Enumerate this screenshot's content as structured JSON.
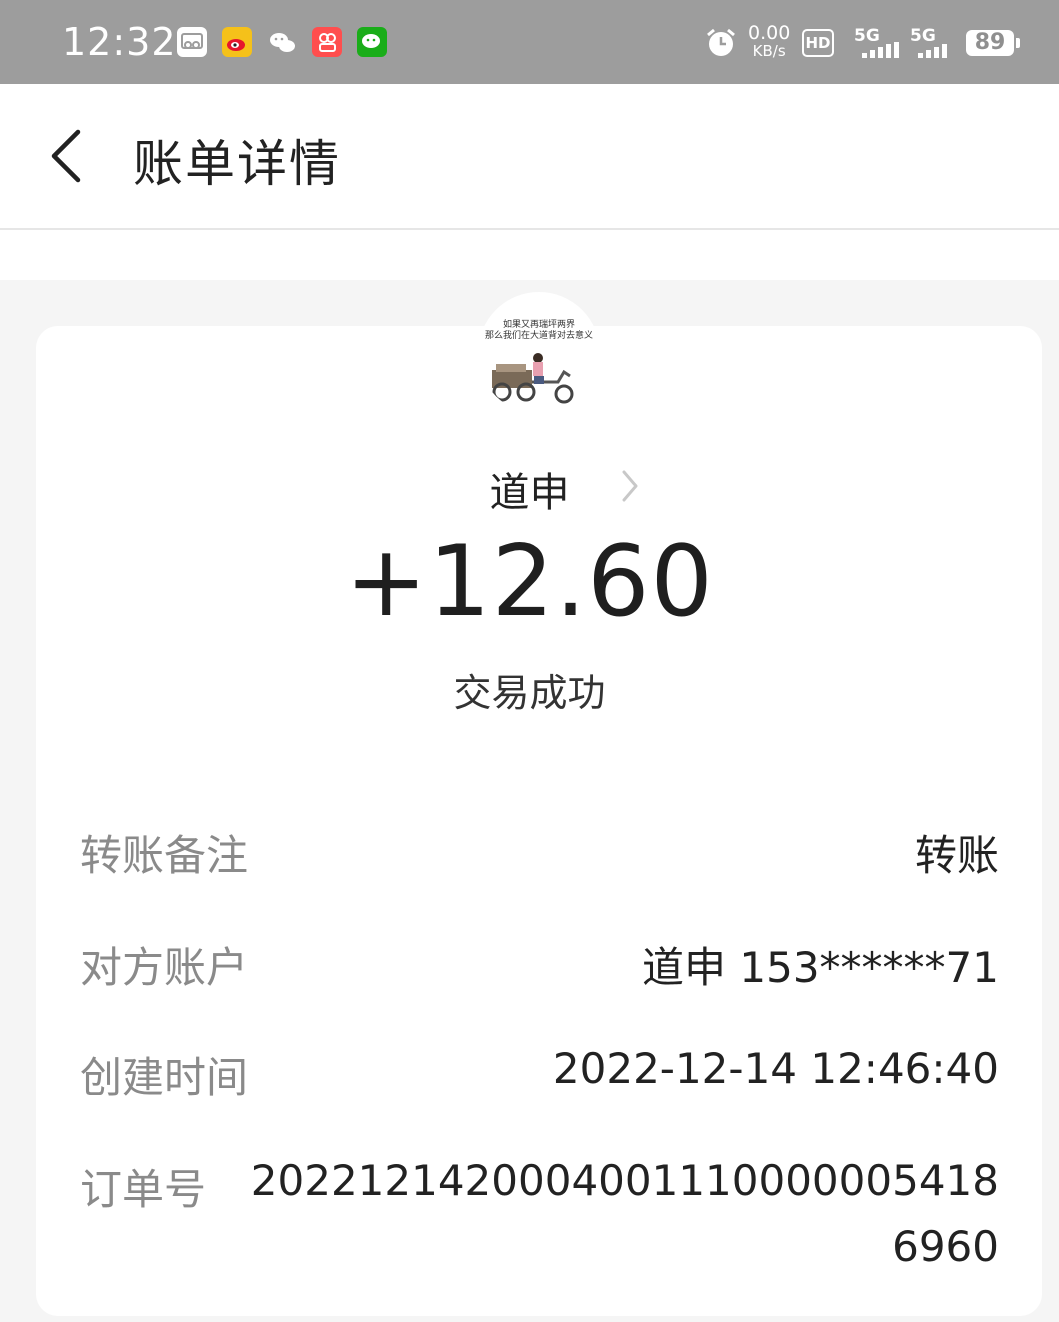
{
  "status_bar": {
    "time": "12:32",
    "net_speed": "0.00",
    "net_unit": "KB/s",
    "hd": "HD",
    "sim1": "5G",
    "sim2": "5G",
    "battery": "89",
    "app_icons": [
      "screen-mirror-icon",
      "weibo-icon",
      "wechat-icon",
      "xiaohongshu-icon",
      "wechat-app-icon"
    ],
    "alarm_icon": "alarm-icon"
  },
  "header": {
    "title": "账单详情",
    "back_icon": "chevron-left-icon"
  },
  "transaction": {
    "avatar_caption_line1": "如果又再瑞坪两界",
    "avatar_caption_line2": "那么我们在大道背对去意义",
    "counterparty_name": "道申",
    "amount": "+12.60",
    "status": "交易成功"
  },
  "details": [
    {
      "label": "转账备注",
      "value": "转账"
    },
    {
      "label": "对方账户",
      "value": "道申 153******71"
    },
    {
      "label": "创建时间",
      "value": "2022-12-14 12:46:40"
    },
    {
      "label": "订单号",
      "value": "2022121420004001110000005418",
      "value_line2": "6960"
    }
  ],
  "colors": {
    "status_bar_bg": "#9d9d9d",
    "page_bg": "#f5f5f5",
    "card_bg": "#ffffff",
    "label_gray": "#8a8a8a",
    "text_dark": "#222222"
  }
}
